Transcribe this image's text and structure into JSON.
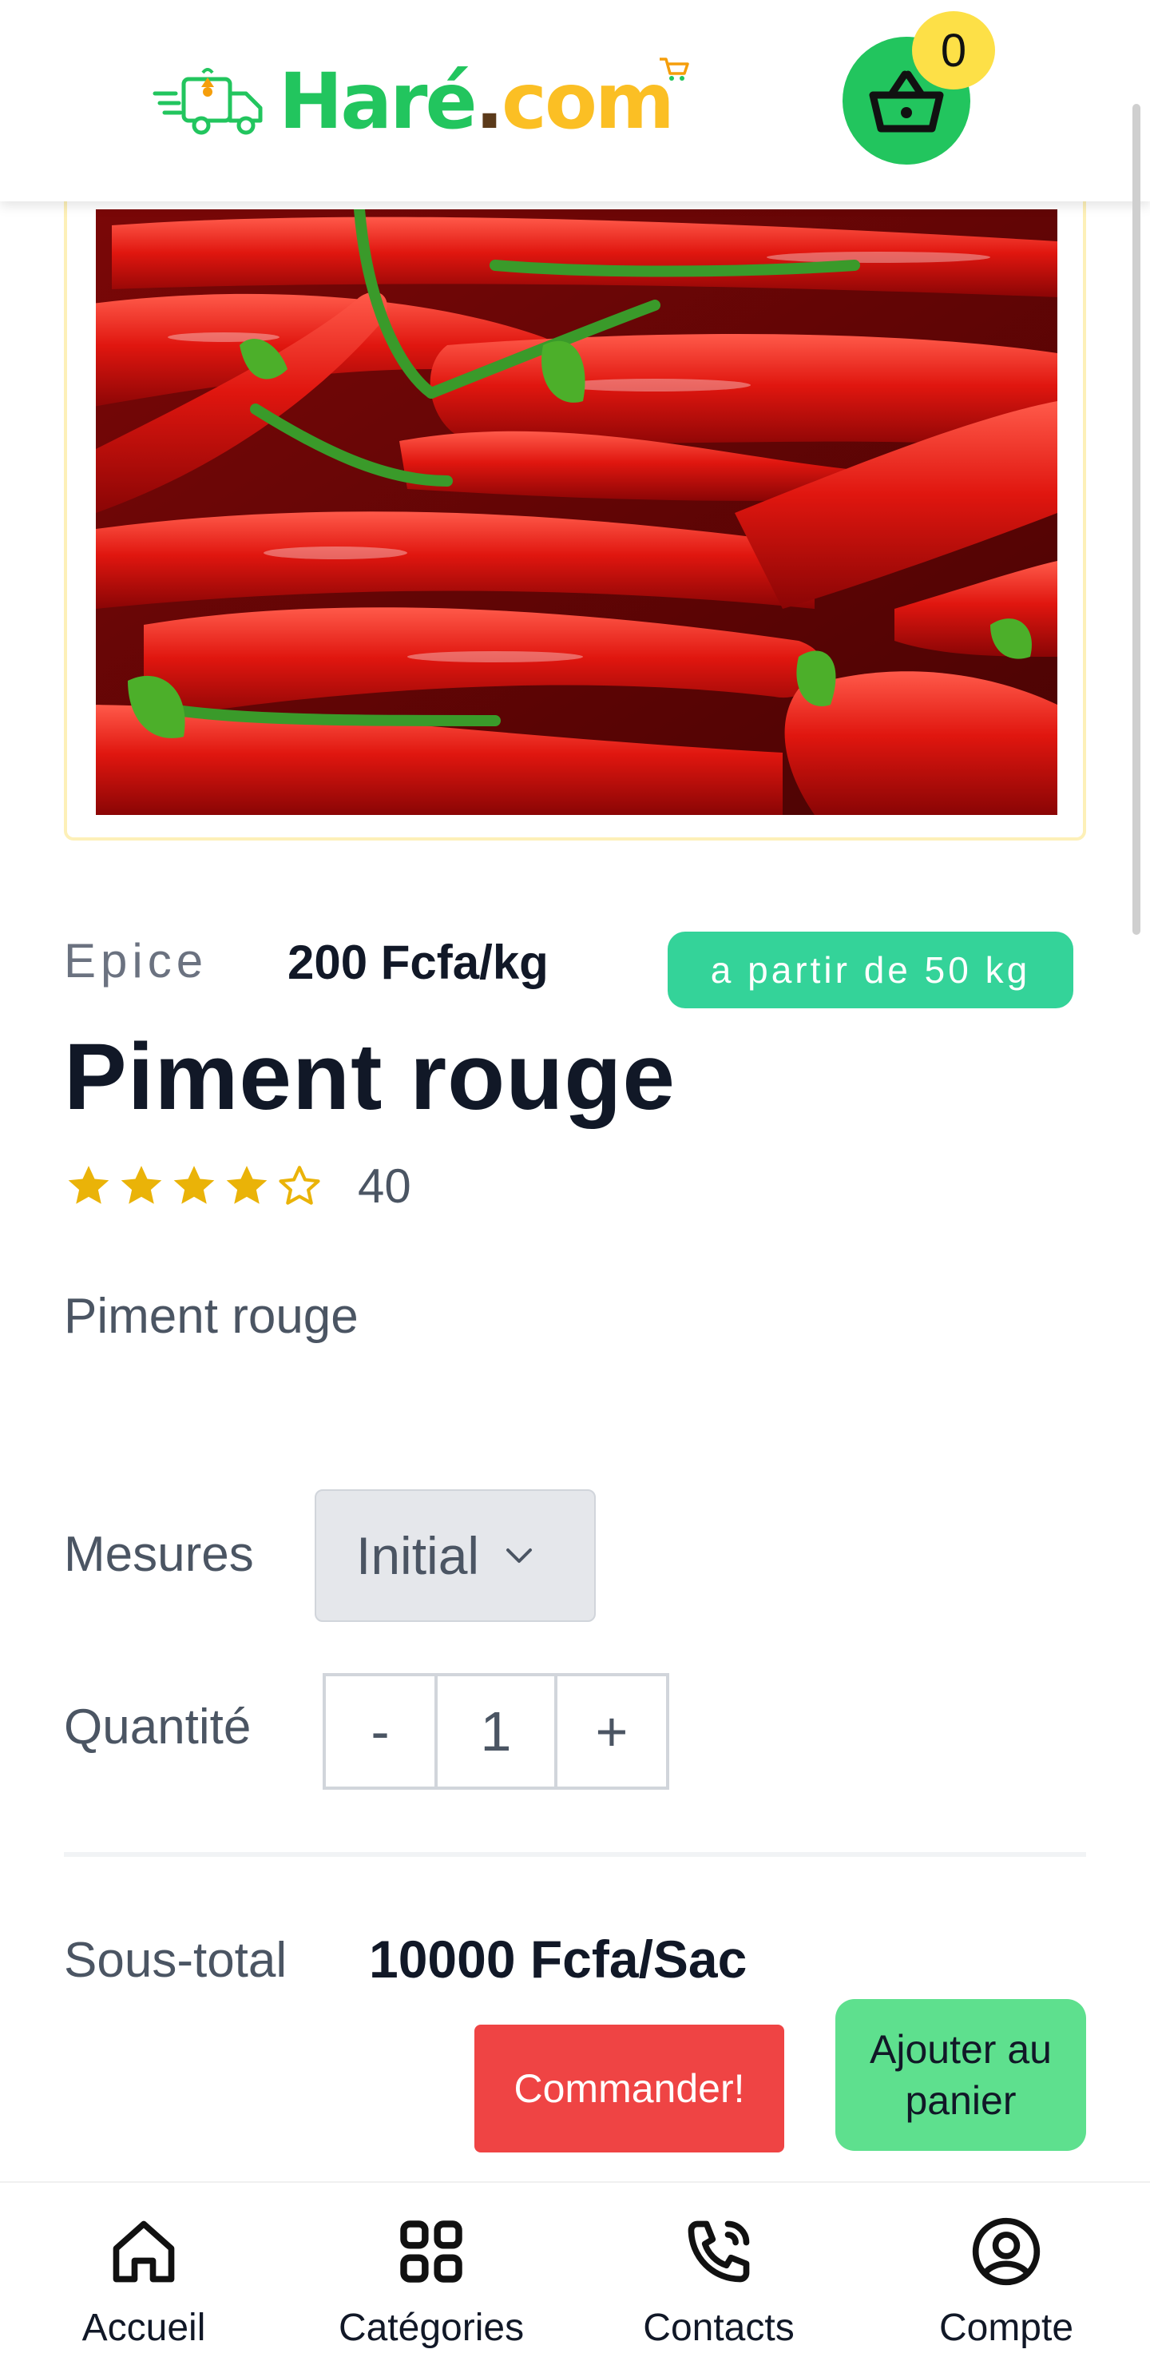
{
  "header": {
    "brand_main": "Haré",
    "brand_dot": ".",
    "brand_tld": "com",
    "cart_count": "0",
    "brand_colors": {
      "green": "#22c55e",
      "yellow": "#fbbf24",
      "brown": "#5b3a1a"
    },
    "icons": [
      "delivery-truck-icon",
      "shopping-basket-icon",
      "mini-cart-icon"
    ]
  },
  "product": {
    "image_subject": "red chili peppers",
    "category": "Epice",
    "price": "200 Fcfa/kg",
    "min_quantity_badge": "a partir de 50 kg",
    "title": "Piment rouge",
    "rating": 4,
    "rating_max": 5,
    "rating_count": "40",
    "description": "Piment rouge"
  },
  "options": {
    "measures_label": "Mesures",
    "measures_selected": "Initial",
    "quantity_label": "Quantité",
    "quantity_minus": "-",
    "quantity_value": "1",
    "quantity_plus": "+"
  },
  "summary": {
    "subtotal_label": "Sous-total",
    "subtotal_value": "10000 Fcfa/Sac",
    "order_button": "Commander!",
    "add_to_cart_button": "Ajouter au panier"
  },
  "nav": {
    "items": [
      {
        "label": "Accueil",
        "icon": "home-icon"
      },
      {
        "label": "Catégories",
        "icon": "grid-icon"
      },
      {
        "label": "Contacts",
        "icon": "phone-icon"
      },
      {
        "label": "Compte",
        "icon": "account-icon"
      }
    ]
  },
  "colors": {
    "accent_green": "#22c55e",
    "badge_teal": "#34d399",
    "order_red": "#ef4444",
    "cart_button_green": "#5ee08e",
    "badge_yellow": "#fde047",
    "star_gold": "#eab308"
  }
}
